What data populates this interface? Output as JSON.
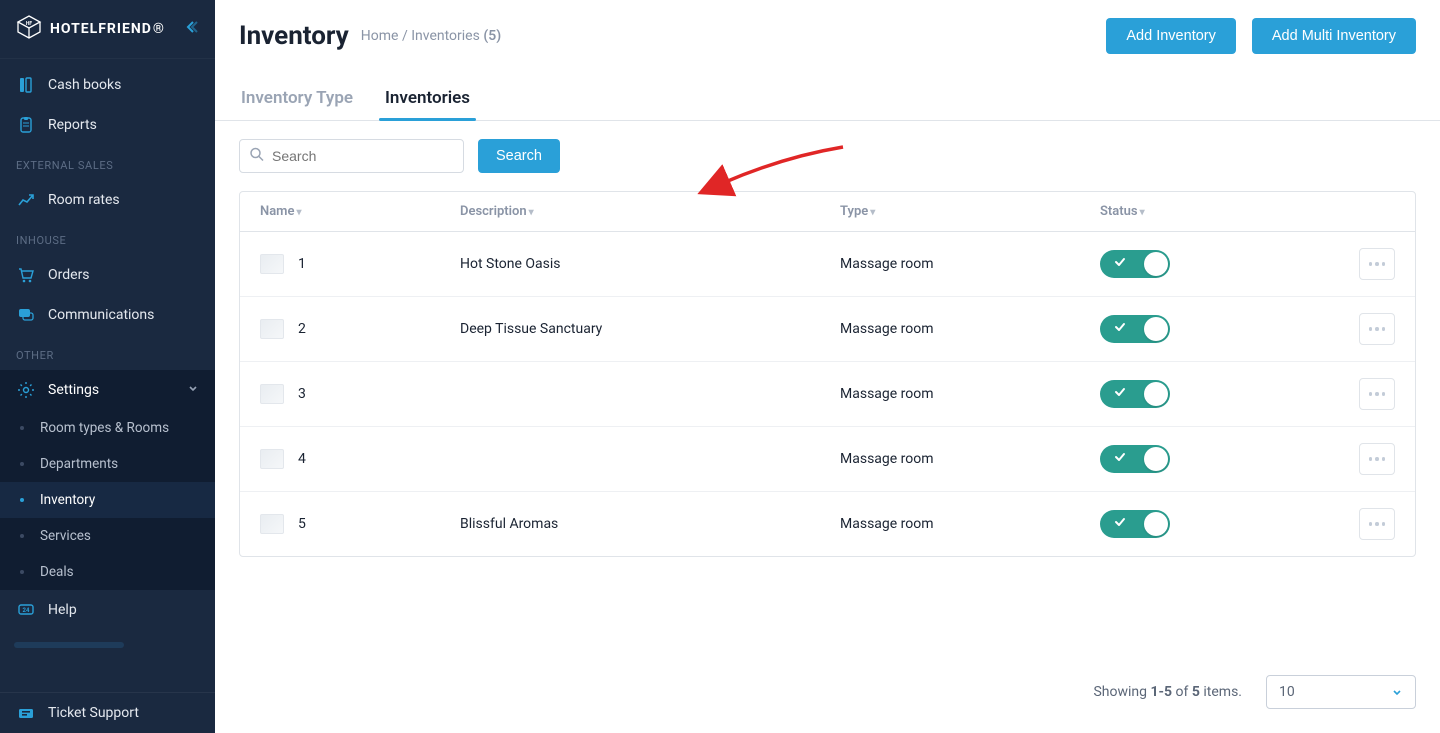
{
  "brand": "HOTELFRIEND",
  "sidebar": {
    "items": [
      {
        "label": "Cash books",
        "icon": "cashbook-icon"
      },
      {
        "label": "Reports",
        "icon": "reports-icon"
      }
    ],
    "section_external_sales": "EXTERNAL SALES",
    "external_sales_items": [
      {
        "label": "Room rates",
        "icon": "room-rates-icon"
      }
    ],
    "section_inhouse": "INHOUSE",
    "inhouse_items": [
      {
        "label": "Orders",
        "icon": "orders-icon"
      },
      {
        "label": "Communications",
        "icon": "communications-icon"
      }
    ],
    "section_other": "OTHER",
    "settings_label": "Settings",
    "settings_sub": [
      {
        "label": "Room types & Rooms"
      },
      {
        "label": "Departments"
      },
      {
        "label": "Inventory",
        "active": true
      },
      {
        "label": "Services"
      },
      {
        "label": "Deals"
      }
    ],
    "help_label": "Help",
    "ticket_support_label": "Ticket Support"
  },
  "header": {
    "title": "Inventory",
    "breadcrumb_home": "Home",
    "breadcrumb_sep": "/",
    "breadcrumb_current": "Inventories",
    "breadcrumb_count": "(5)",
    "add_inventory": "Add Inventory",
    "add_multi_inventory": "Add Multi Inventory"
  },
  "tabs": {
    "inventory_type": "Inventory Type",
    "inventories": "Inventories"
  },
  "search": {
    "placeholder": "Search",
    "button": "Search"
  },
  "columns": {
    "name": "Name",
    "description": "Description",
    "type": "Type",
    "status": "Status"
  },
  "rows": [
    {
      "name": "1",
      "description": "Hot Stone Oasis",
      "type": "Massage room",
      "status": true
    },
    {
      "name": "2",
      "description": "Deep Tissue Sanctuary",
      "type": "Massage room",
      "status": true
    },
    {
      "name": "3",
      "description": "",
      "type": "Massage room",
      "status": true
    },
    {
      "name": "4",
      "description": "",
      "type": "Massage room",
      "status": true
    },
    {
      "name": "5",
      "description": "Blissful Aromas",
      "type": "Massage room",
      "status": true
    }
  ],
  "pagination": {
    "prefix": "Showing ",
    "range": "1-5",
    "of": " of ",
    "total": "5",
    "suffix": " items.",
    "per_page": "10"
  }
}
